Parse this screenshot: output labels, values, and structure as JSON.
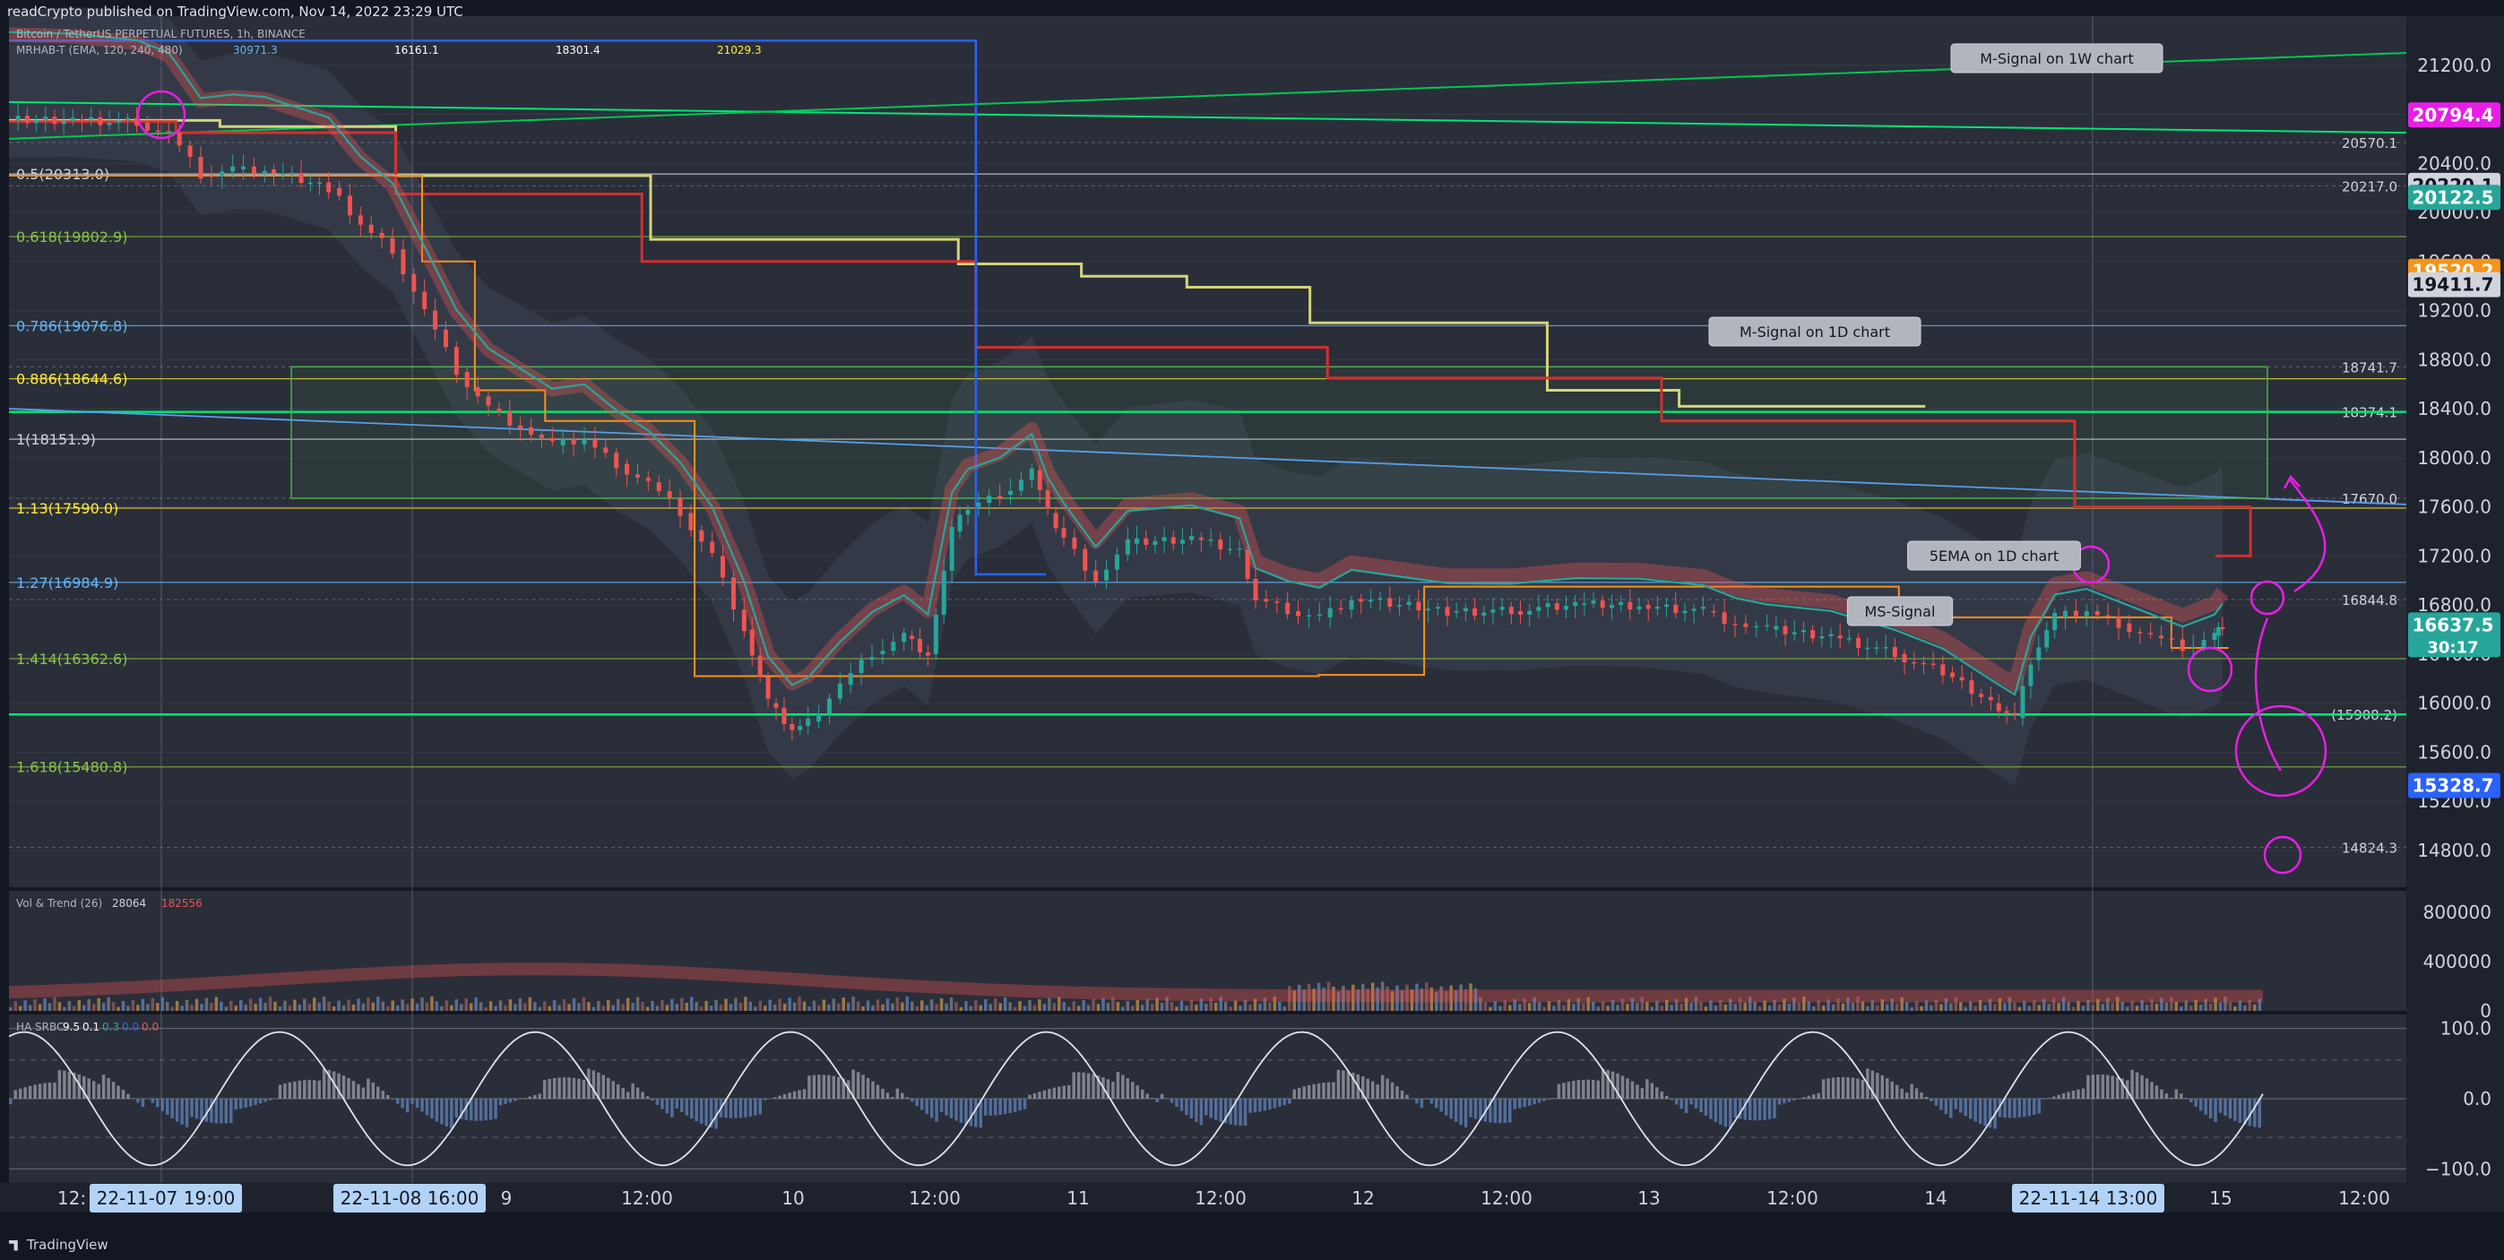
{
  "header": {
    "published": "readCrypto published on TradingView.com, Nov 14, 2022 23:29 UTC",
    "legend_line1": "Bitcoin / TetherUS PERPETUAL FUTURES, 1h, BINANCE",
    "legend_line2": "MRHAB-T (EMA, 120, 240, 480)",
    "legend_values": [
      "30971.3",
      "16161.1",
      "18301.4",
      "21029.3"
    ]
  },
  "footer": {
    "brand": "TradingView"
  },
  "colors": {
    "bg": "#131722",
    "main_bg": "#2a2e39",
    "up": "#26a69a",
    "down": "#ef5350",
    "red_line": "#d32f2f",
    "yellow_line": "#d4d47a",
    "blue_line": "#2962ff",
    "green_line": "#00e676",
    "orange": "#f7931a",
    "magenta": "#e91ee6"
  },
  "chart_data": [
    {
      "type": "line",
      "title": "Bitcoin / TetherUS PERPETUAL FUTURES, 1h, BINANCE",
      "y_range": [
        14500,
        21600
      ],
      "y_ticks": [
        "21200.0",
        "20800.0",
        "20400.0",
        "20000.0",
        "19600.0",
        "19200.0",
        "18800.0",
        "18400.0",
        "18000.0",
        "17600.0",
        "17200.0",
        "16800.0",
        "16400.0",
        "16000.0",
        "15600.0",
        "15200.0",
        "14800.0"
      ],
      "x_ticks": [
        "12:",
        "9",
        "12:00",
        "10",
        "12:00",
        "11",
        "12:00",
        "12",
        "12:00",
        "13",
        "12:00",
        "14",
        "15",
        "12:00"
      ],
      "x_highlights": [
        "22-11-07  19:00",
        "22-11-08  16:00",
        "22-11-14  13:00"
      ],
      "price_series": [
        [
          0,
          20750
        ],
        [
          40,
          20760
        ],
        [
          80,
          20730
        ],
        [
          100,
          20650
        ],
        [
          120,
          20300
        ],
        [
          140,
          20350
        ],
        [
          160,
          20350
        ],
        [
          200,
          20200
        ],
        [
          220,
          19900
        ],
        [
          240,
          19700
        ],
        [
          260,
          19200
        ],
        [
          280,
          18700
        ],
        [
          300,
          18400
        ],
        [
          320,
          18250
        ],
        [
          340,
          18100
        ],
        [
          360,
          18150
        ],
        [
          380,
          17950
        ],
        [
          400,
          17800
        ],
        [
          420,
          17550
        ],
        [
          440,
          17200
        ],
        [
          460,
          16600
        ],
        [
          475,
          16000
        ],
        [
          490,
          15780
        ],
        [
          500,
          15850
        ],
        [
          520,
          16150
        ],
        [
          540,
          16400
        ],
        [
          560,
          16550
        ],
        [
          575,
          16400
        ],
        [
          590,
          17400
        ],
        [
          600,
          17600
        ],
        [
          620,
          17700
        ],
        [
          640,
          17900
        ],
        [
          650,
          17550
        ],
        [
          660,
          17350
        ],
        [
          680,
          17000
        ],
        [
          700,
          17300
        ],
        [
          740,
          17350
        ],
        [
          770,
          17250
        ],
        [
          780,
          16850
        ],
        [
          800,
          16750
        ],
        [
          820,
          16700
        ],
        [
          840,
          16850
        ],
        [
          870,
          16800
        ],
        [
          900,
          16750
        ],
        [
          940,
          16750
        ],
        [
          980,
          16800
        ],
        [
          1020,
          16800
        ],
        [
          1060,
          16750
        ],
        [
          1080,
          16650
        ],
        [
          1100,
          16600
        ],
        [
          1140,
          16550
        ],
        [
          1180,
          16400
        ],
        [
          1210,
          16250
        ],
        [
          1240,
          16000
        ],
        [
          1255,
          15880
        ],
        [
          1265,
          16350
        ],
        [
          1280,
          16700
        ],
        [
          1300,
          16750
        ],
        [
          1320,
          16650
        ],
        [
          1340,
          16550
        ],
        [
          1360,
          16450
        ],
        [
          1380,
          16550
        ],
        [
          1385,
          16640
        ]
      ],
      "hline_labels": [
        {
          "text": "0.5(20313.0)",
          "value": 20313.0,
          "color": "#d1d4dc"
        },
        {
          "text": "0.618(19802.9)",
          "value": 19802.9,
          "color": "#8bc34a"
        },
        {
          "text": "0.786(19076.8)",
          "value": 19076.8,
          "color": "#64b5f6"
        },
        {
          "text": "0.886(18644.6)",
          "value": 18644.6,
          "color": "#ffeb3b"
        },
        {
          "text": "1(18151.9)",
          "value": 18151.9,
          "color": "#d1d4dc"
        },
        {
          "text": "1.13(17590.0)",
          "value": 17590.0,
          "color": "#ffeb3b"
        },
        {
          "text": "1.27(16984.9)",
          "value": 16984.9,
          "color": "#64b5f6"
        },
        {
          "text": "1.414(16362.6)",
          "value": 16362.6,
          "color": "#8bc34a"
        },
        {
          "text": "1.618(15480.8)",
          "value": 15480.8,
          "color": "#8bc34a"
        }
      ],
      "right_levels": [
        "20570.1",
        "20217.0",
        "18741.7",
        "18374.1",
        "17670.0",
        "16844.8",
        "(15908.2)",
        "14824.3"
      ],
      "right_level_values": [
        20570.1,
        20217.0,
        18741.7,
        18374.1,
        17670.0,
        16844.8,
        15908.2,
        14824.3
      ],
      "price_badges": [
        {
          "text": "20794.4",
          "value": 20794.4,
          "color": "#e91ee6"
        },
        {
          "text": "20220.1",
          "value": 20220.1,
          "color": "#d1d4dc"
        },
        {
          "text": "20122.5",
          "value": 20122.5,
          "color": "#26a69a"
        },
        {
          "text": "19520.2",
          "value": 19520.2,
          "color": "#f7931a"
        },
        {
          "text": "19411.7",
          "value": 19411.7,
          "color": "#d1d4dc"
        },
        {
          "text": "16637.5",
          "value": 16637.5,
          "color": "#26a69a"
        },
        {
          "text": "15328.7",
          "value": 15328.7,
          "color": "#2962ff"
        }
      ],
      "countdown": "30:17",
      "callouts": [
        "M-Signal on 1W chart",
        "M-Signal on 1D chart",
        "5EMA on 1D chart",
        "MS-Signal"
      ]
    },
    {
      "type": "bar",
      "title": "Vol & Trend (26)",
      "values_text": [
        "28064",
        "182556"
      ],
      "y_ticks": [
        "800000",
        "400000",
        "0"
      ],
      "y_range": [
        0,
        900000
      ]
    },
    {
      "type": "line",
      "title": "HA SRBC",
      "values_text": [
        "9.5",
        "0.1",
        "0.3",
        "0.0",
        "0.0"
      ],
      "y_ticks": [
        "100.0",
        "0.0",
        "−100.0"
      ],
      "y_range": [
        -120,
        120
      ]
    }
  ]
}
